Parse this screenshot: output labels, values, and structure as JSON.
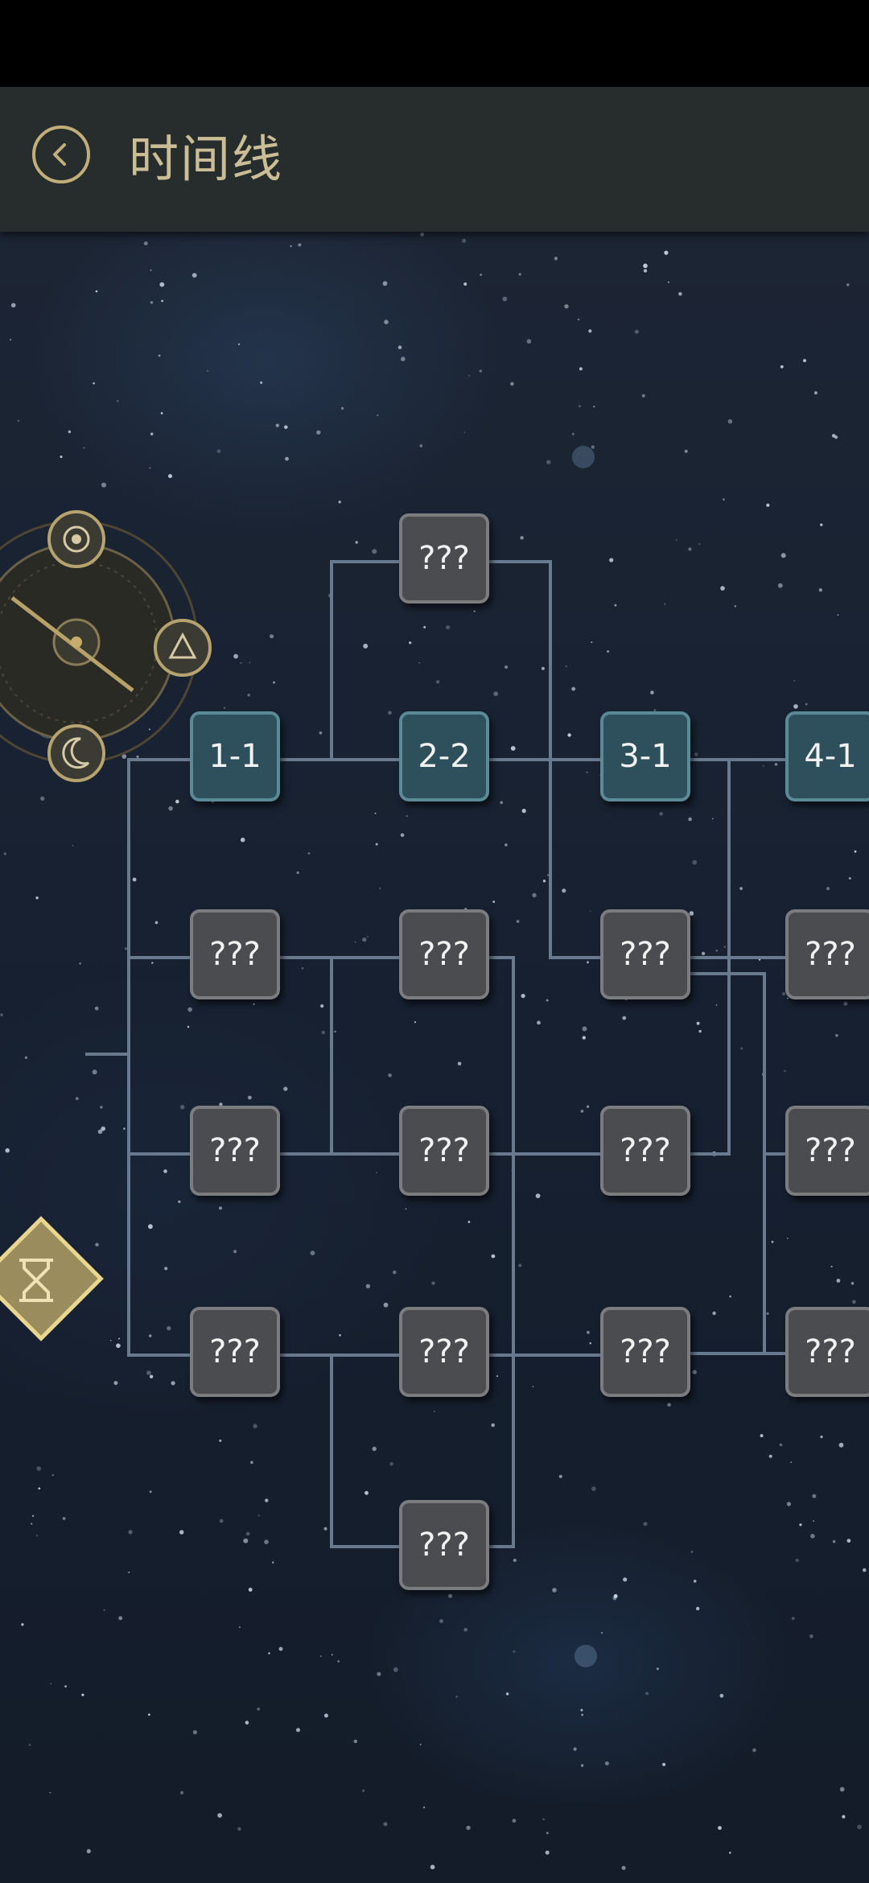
{
  "header": {
    "title": "时间线",
    "back_icon": "chevron-left-icon"
  },
  "compass": {
    "top_icon": "target-icon",
    "right_icon": "triangle-icon",
    "bottom_icon": "moon-icon"
  },
  "start_node": {
    "icon": "hourglass-icon"
  },
  "nodes": {
    "n1": "???",
    "n2": "1-1",
    "n3": "2-2",
    "n4": "3-1",
    "n5": "4-1",
    "n6": "???",
    "n7": "???",
    "n8": "???",
    "n9": "???",
    "n10": "???",
    "n11": "???",
    "n12": "???",
    "n13": "???",
    "n14": "???",
    "n15": "???",
    "n16": "???",
    "n17": "???",
    "n18": "???"
  },
  "colors": {
    "accent_gold": "#c2ae7a",
    "node_open": "#2e4f5c",
    "node_locked": "#4a4c50",
    "line": "#6a7a8e"
  }
}
